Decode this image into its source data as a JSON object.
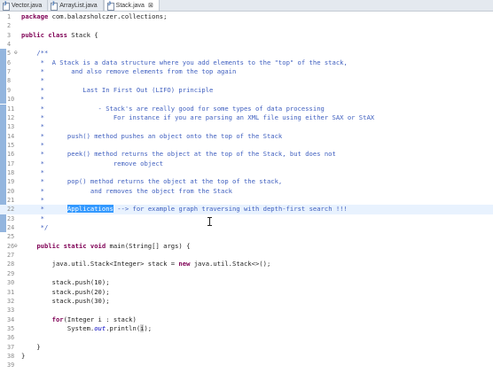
{
  "tabs": [
    {
      "label": "Vector.java",
      "active": false
    },
    {
      "label": "ArrayList.java",
      "active": false
    },
    {
      "label": "Stack.java",
      "active": true,
      "close": "⊠"
    }
  ],
  "fold_glyph": "⊖",
  "lines": [
    {
      "n": "1",
      "html": "<span class='kw'>package</span> com.balazsholczer.collections;"
    },
    {
      "n": "2",
      "html": ""
    },
    {
      "n": "3",
      "html": "<span class='kw'>public class</span> Stack {"
    },
    {
      "n": "4",
      "html": ""
    },
    {
      "n": "5",
      "fold": true,
      "html": "    <span class='cm'>/**</span>"
    },
    {
      "n": "6",
      "html": "<span class='cm'>     *  A Stack is a data structure where you add elements to the \"top\" of the stack,</span>"
    },
    {
      "n": "7",
      "html": "<span class='cm'>     *       and also remove elements from the top again</span>"
    },
    {
      "n": "8",
      "html": "<span class='cm'>     *</span>"
    },
    {
      "n": "9",
      "html": "<span class='cm'>     *          Last In First Out (LIFO) principle</span>"
    },
    {
      "n": "10",
      "html": "<span class='cm'>     *</span>"
    },
    {
      "n": "11",
      "html": "<span class='cm'>     *              - Stack's are really good for some types of data processing</span>"
    },
    {
      "n": "12",
      "html": "<span class='cm'>     *                  For instance if you are parsing an XML file using either SAX or StAX</span>"
    },
    {
      "n": "13",
      "html": "<span class='cm'>     *</span>"
    },
    {
      "n": "14",
      "html": "<span class='cm'>     *      push() method pushes an object onto the top of the Stack</span>"
    },
    {
      "n": "15",
      "html": "<span class='cm'>     *</span>"
    },
    {
      "n": "16",
      "html": "<span class='cm'>     *      peek() method returns the object at the top of the Stack, but does not</span>"
    },
    {
      "n": "17",
      "html": "<span class='cm'>     *                  remove object</span>"
    },
    {
      "n": "18",
      "html": "<span class='cm'>     *</span>"
    },
    {
      "n": "19",
      "html": "<span class='cm'>     *      pop() method returns the object at the top of the stack,</span>"
    },
    {
      "n": "20",
      "html": "<span class='cm'>     *            and removes the object from the Stack</span>"
    },
    {
      "n": "21",
      "html": "<span class='cm'>     *</span>"
    },
    {
      "n": "22",
      "current": true,
      "html": "<span class='cm'>     *      </span><span class='sel'>Applications</span><span class='cm'> --&gt; for example graph traversing with depth-first search !!!</span>"
    },
    {
      "n": "23",
      "html": "<span class='cm'>     *</span>"
    },
    {
      "n": "24",
      "html": "<span class='cm'>     */</span>"
    },
    {
      "n": "25",
      "html": ""
    },
    {
      "n": "26",
      "fold": true,
      "html": "    <span class='kw'>public static void</span> main(String[] args) {"
    },
    {
      "n": "27",
      "html": ""
    },
    {
      "n": "28",
      "html": "        java.util.Stack&lt;Integer&gt; stack = <span class='kw'>new</span> java.util.Stack&lt;&gt;();"
    },
    {
      "n": "29",
      "html": ""
    },
    {
      "n": "30",
      "html": "        stack.push(10);"
    },
    {
      "n": "31",
      "html": "        stack.push(20);"
    },
    {
      "n": "32",
      "html": "        stack.push(30);"
    },
    {
      "n": "33",
      "html": ""
    },
    {
      "n": "34",
      "html": "        <span class='kw'>for</span>(Integer i : stack)"
    },
    {
      "n": "35",
      "html": "            System.<span class='st'>out</span>.println(<span class='hl'>i</span>);"
    },
    {
      "n": "36",
      "html": ""
    },
    {
      "n": "37",
      "html": "    }"
    },
    {
      "n": "38",
      "html": "}"
    },
    {
      "n": "39",
      "html": ""
    }
  ]
}
